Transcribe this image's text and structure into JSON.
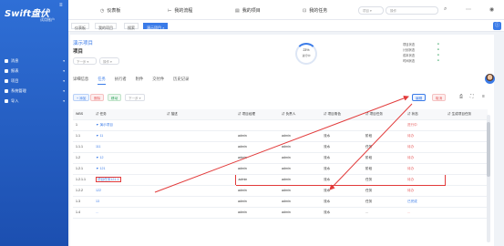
{
  "sidebar": {
    "logo": "Swift盘伏",
    "logo_sub": "试用账户",
    "items": [
      {
        "label": "消息",
        "icon": "message-icon"
      },
      {
        "label": "报表",
        "icon": "chart-icon"
      },
      {
        "label": "项目",
        "icon": "project-icon"
      },
      {
        "label": "系统管理",
        "icon": "settings-icon"
      },
      {
        "label": "导入",
        "icon": "import-icon"
      }
    ]
  },
  "topbar": {
    "nav": [
      {
        "label": "仪表板",
        "icon": "dashboard-icon"
      },
      {
        "label": "我的流程",
        "icon": "flow-icon"
      },
      {
        "label": "我的项目",
        "icon": "project-icon"
      },
      {
        "label": "我的任务",
        "icon": "task-icon"
      }
    ],
    "search_type": "项目",
    "search_placeholder": "操作"
  },
  "tabs": [
    {
      "label": "仪表板"
    },
    {
      "label": "我的项目"
    },
    {
      "label": "搜索"
    },
    {
      "label": "演示项目 ×",
      "active": true
    }
  ],
  "project": {
    "title": "演示项目",
    "subtitle": "项目",
    "select1": "下一步",
    "select2": "操作",
    "progress_value": "23%",
    "progress_label": "进行中",
    "stats": [
      {
        "label": "项目状态",
        "value": "●"
      },
      {
        "label": "计划状态",
        "value": "●"
      },
      {
        "label": "成本状态",
        "value": "●"
      },
      {
        "label": "时间状态",
        "value": "●"
      }
    ]
  },
  "subtabs": [
    "详细信息",
    "任务",
    "执行者",
    "附件",
    "交付件",
    "历史记录"
  ],
  "toolbar": {
    "add": "+ 添加",
    "delete": "删除",
    "move": "移动",
    "select_placeholder": "下一步",
    "edit": "编辑",
    "cancel": "取消"
  },
  "table": {
    "headers": [
      "WBS",
      "任务",
      "描述",
      "项目经理",
      "负责人",
      "项目角色",
      "项目任务",
      "状态",
      "生成项目任务"
    ],
    "rows": [
      {
        "wbs": "1",
        "name": "▼ 演示项目",
        "pm": "",
        "owner": "",
        "role": "",
        "task": "",
        "status": "进行中",
        "status_class": "st-red"
      },
      {
        "wbs": "1.1",
        "name": "▼ 11",
        "pm": "admin",
        "owner": "admin",
        "role": "流水",
        "task": "阶段",
        "status": "待办",
        "status_class": "st-red"
      },
      {
        "wbs": "1.1.1",
        "name": "111",
        "pm": "admin",
        "owner": "admin",
        "role": "流水",
        "task": "任务",
        "status": "待办",
        "status_class": "st-red"
      },
      {
        "wbs": "1.2",
        "name": "▼ 12",
        "pm": "admin",
        "owner": "admin",
        "role": "流水",
        "task": "阶段",
        "status": "待办",
        "status_class": "st-red"
      },
      {
        "wbs": "1.2.1",
        "name": "▼ 121",
        "pm": "admin",
        "owner": "admin",
        "role": "流水",
        "task": "阶段",
        "status": "待办",
        "status_class": "st-red"
      },
      {
        "wbs": "1.2.1.1",
        "name": "项目任务121-1",
        "pm": "admin",
        "owner": "admin",
        "role": "流水",
        "task": "任务",
        "status": "待办",
        "status_class": "st-red",
        "highlight": true
      },
      {
        "wbs": "1.2.2",
        "name": "122",
        "pm": "admin",
        "owner": "admin",
        "role": "流水",
        "task": "任务",
        "status": "待办",
        "status_class": "st-red"
      },
      {
        "wbs": "1.3",
        "name": "13",
        "pm": "admin",
        "owner": "admin",
        "role": "流水",
        "task": "任务",
        "status": "已完成",
        "status_class": "st-blue"
      },
      {
        "wbs": "1.4",
        "name": "...",
        "pm": "admin",
        "owner": "admin",
        "role": "流水",
        "task": "...",
        "status": "...",
        "status_class": "st-red"
      }
    ]
  },
  "colors": {
    "accent": "#3a7be8",
    "sidebar": "#2f6fd6",
    "highlight": "#e23b3b"
  }
}
